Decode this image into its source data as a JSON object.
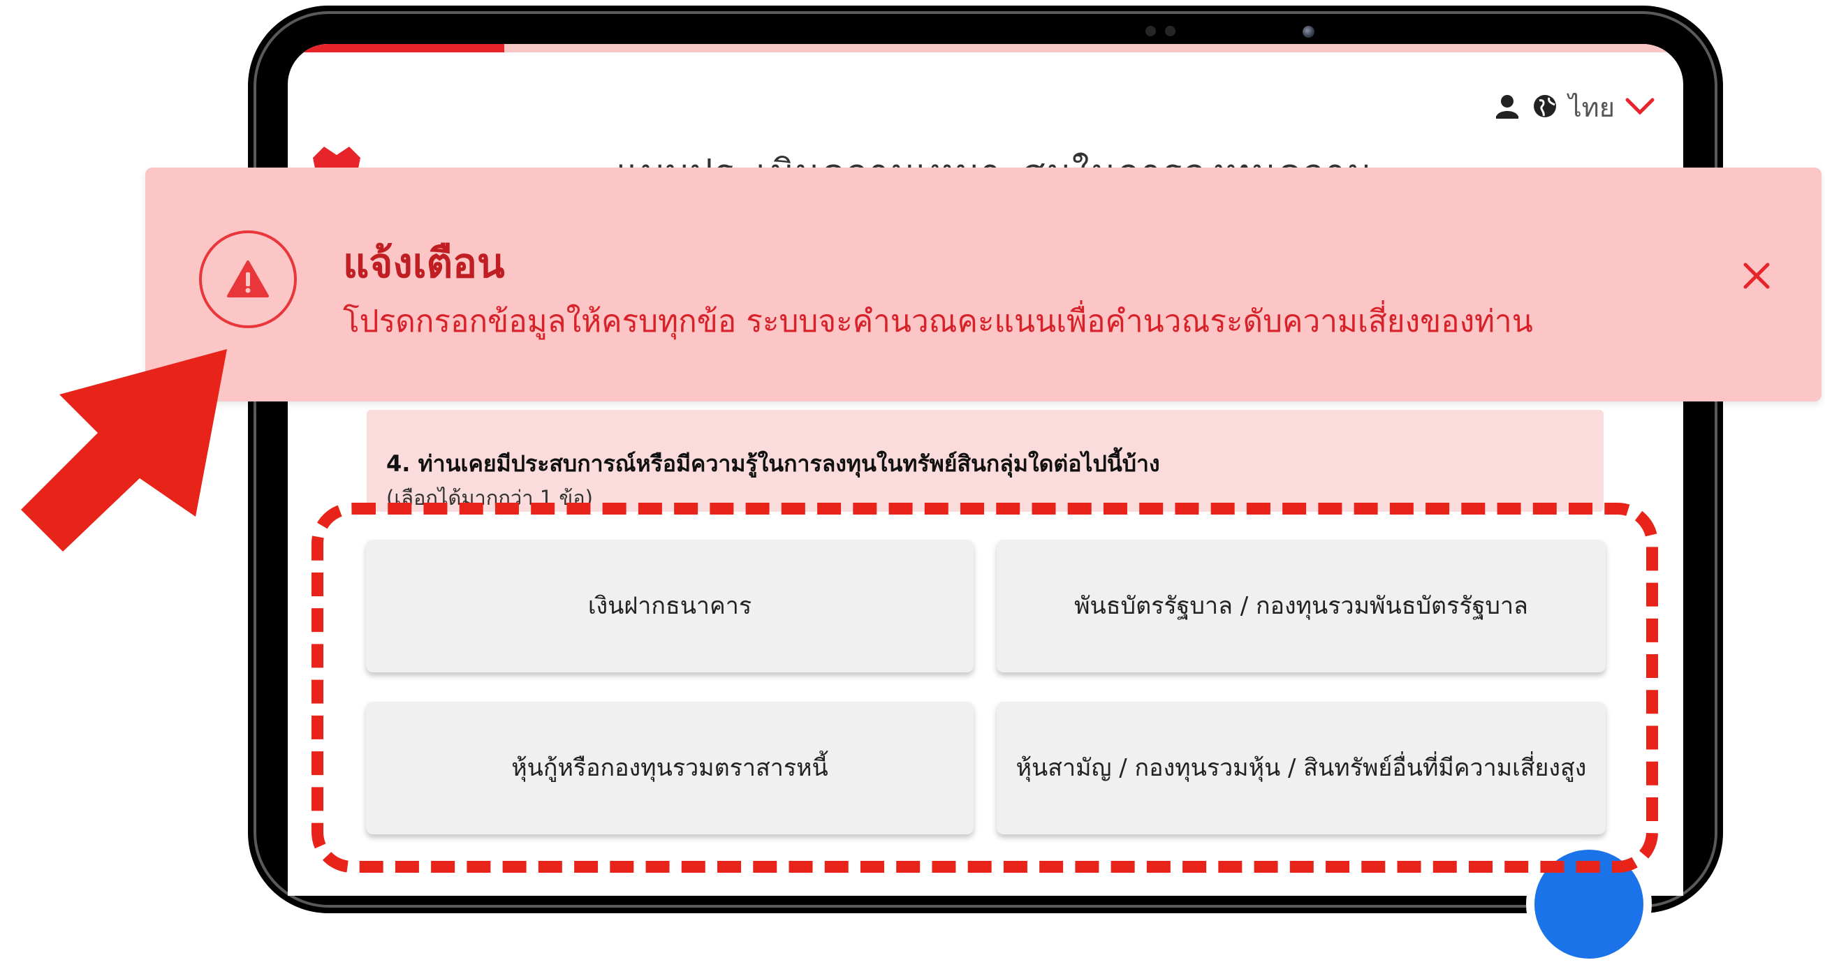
{
  "header": {
    "language": "ไทย",
    "title_partial": "แบบประเมินความเหมาะสมในการลงทุนความเสี่ยง"
  },
  "alert": {
    "title": "แจ้งเตือน",
    "message": "โปรดกรอกข้อมูลให้ครบทุกข้อ ระบบจะคำนวณคะแนนเพื่อคำนวณระดับความเสี่ยงของท่าน",
    "icon": "warning-triangle-icon",
    "close_icon": "close-icon"
  },
  "question": {
    "text": "4. ท่านเคยมีประสบการณ์หรือมีความรู้ในการลงทุนในทรัพย์สินกลุ่มใดต่อไปนี้บ้าง",
    "hint": "(เลือกได้มากกว่า 1 ข้อ)"
  },
  "options": [
    {
      "label": "เงินฝากธนาคาร"
    },
    {
      "label": "พันธบัตรรัฐบาล / กองทุนรวมพันธบัตรรัฐบาล"
    },
    {
      "label": "หุ้นกู้หรือกองทุนรวมตราสารหนี้"
    },
    {
      "label": "หุ้นสามัญ / กองทุนรวมหุ้น / สินทรัพย์อื่นที่มีความเสี่ยงสูง"
    }
  ],
  "colors": {
    "brand_red": "#e8242b",
    "alert_bg": "#fdc6c6",
    "question_bg": "#fbdcdc",
    "option_bg": "#f0f0f0",
    "annotation_red": "#e8241a"
  },
  "progress": 0.155
}
